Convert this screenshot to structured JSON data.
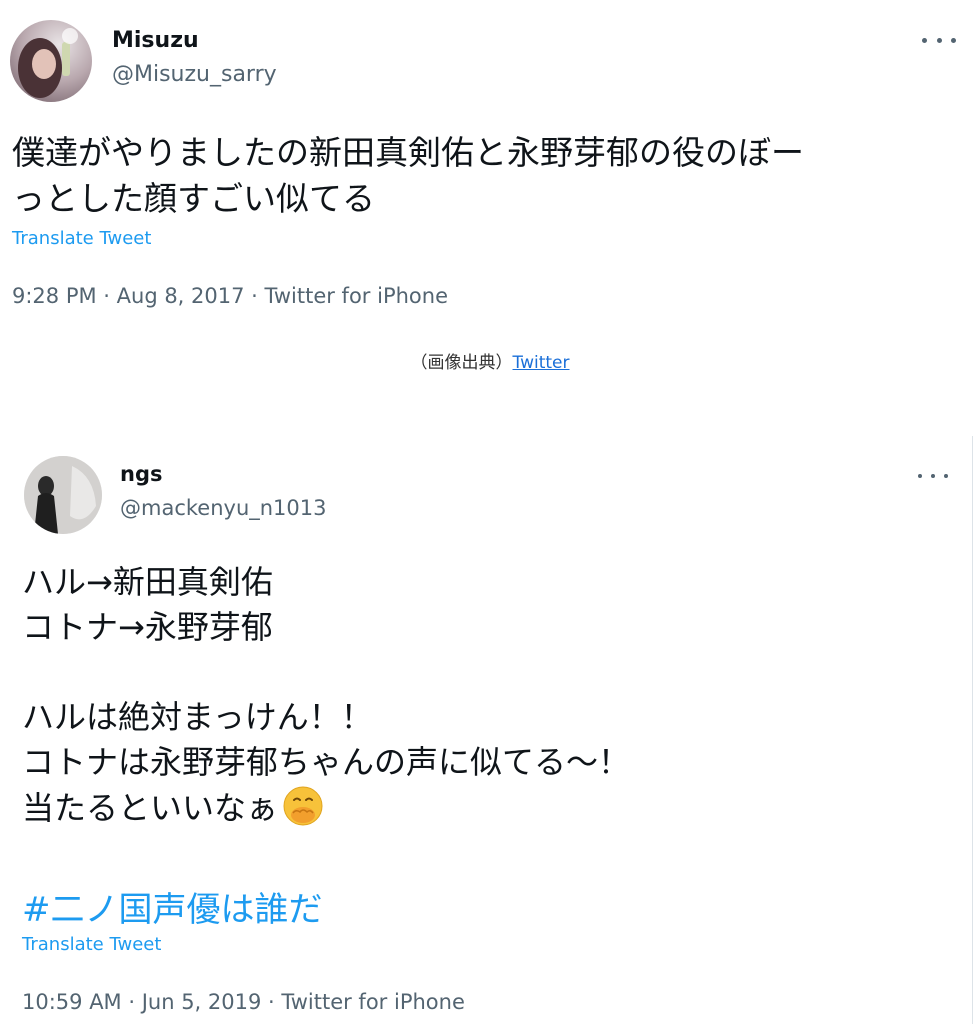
{
  "tweet1": {
    "name": "Misuzu",
    "handle": "@Misuzu_sarry",
    "text": "僕達がやりましたの新田真剣佑と永野芽郁の役のぼー\nっとした顔すごい似てる",
    "translate_label": "Translate Tweet",
    "meta": "9:28 PM · Aug 8, 2017 · Twitter for iPhone",
    "more_icon": "more-horizontal-icon"
  },
  "caption": {
    "prefix": "（画像出典）",
    "link": "Twitter"
  },
  "tweet2": {
    "name": "ngs",
    "handle": "@mackenyu_n1013",
    "lines": [
      "ハル→新田真剣佑",
      "コトナ→永野芽郁",
      "",
      "ハルは絶対まっけん！！",
      "コトナは永野芽郁ちゃんの声に似てる〜！",
      "当たるといいなぁ"
    ],
    "emoji_icon": "face-with-hand-over-mouth-icon",
    "hashtag": "#二ノ国声優は誰だ",
    "translate_label": "Translate Tweet",
    "meta": "10:59 AM · Jun 5, 2019 · Twitter for iPhone",
    "more_icon": "more-horizontal-icon"
  },
  "colors": {
    "text": "#0f1419",
    "secondary": "#536471",
    "link_blue": "#1d9bf0",
    "caption_link": "#1a6fd8"
  }
}
